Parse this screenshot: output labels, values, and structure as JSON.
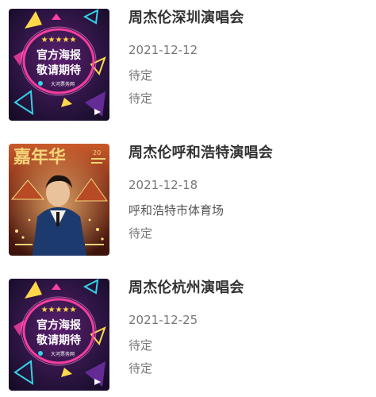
{
  "events": [
    {
      "title": "周杰伦深圳演唱会",
      "date": "2021-12-12",
      "venue": "待定",
      "price": "待定",
      "poster": {
        "type": "official-poster-placeholder",
        "line1": "官方海报",
        "line2": "敬请期待",
        "brand": "大河票务网"
      }
    },
    {
      "title": "周杰伦呼和浩特演唱会",
      "date": "2021-12-18",
      "venue": "呼和浩特市体育场",
      "price": "待定",
      "poster": {
        "type": "artist-photo",
        "headline": "嘉年华"
      }
    },
    {
      "title": "周杰伦杭州演唱会",
      "date": "2021-12-25",
      "venue": "待定",
      "price": "待定",
      "poster": {
        "type": "official-poster-placeholder",
        "line1": "官方海报",
        "line2": "敬请期待",
        "brand": "大河票务网"
      }
    }
  ],
  "colors": {
    "title": "#333333",
    "meta": "#777777",
    "poster_bg": "#2a1440",
    "neon_pink": "#ff3fa4",
    "star_yellow": "#ffd84a"
  }
}
